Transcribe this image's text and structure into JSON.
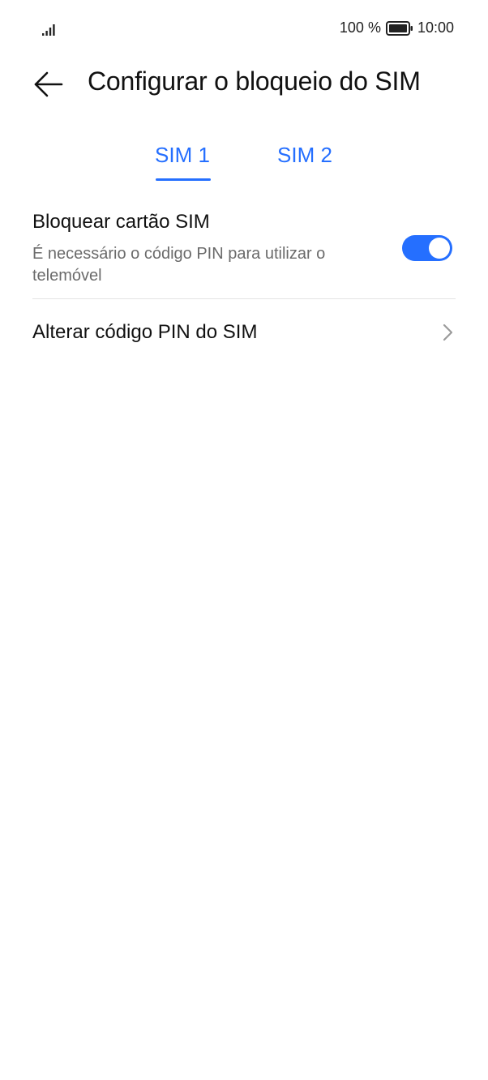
{
  "status_bar": {
    "battery_percent": "100 %",
    "time": "10:00",
    "signal_icon": "signal-bars-icon",
    "battery_icon": "battery-full-icon"
  },
  "header": {
    "title": "Configurar o bloqueio do SIM",
    "back_icon": "arrow-left-icon"
  },
  "tabs": [
    {
      "label": "SIM 1",
      "selected": true
    },
    {
      "label": "SIM 2",
      "selected": false
    }
  ],
  "settings": {
    "lock_sim": {
      "title": "Bloquear cartão SIM",
      "subtitle": "É necessário o código PIN para utilizar o telemóvel",
      "enabled": true
    },
    "change_pin": {
      "title": "Alterar código PIN do SIM",
      "icon": "chevron-right-icon"
    }
  },
  "colors": {
    "accent": "#256fff",
    "text_primary": "#111111",
    "text_secondary": "#6b6b6b",
    "divider": "#e3e3e3"
  }
}
